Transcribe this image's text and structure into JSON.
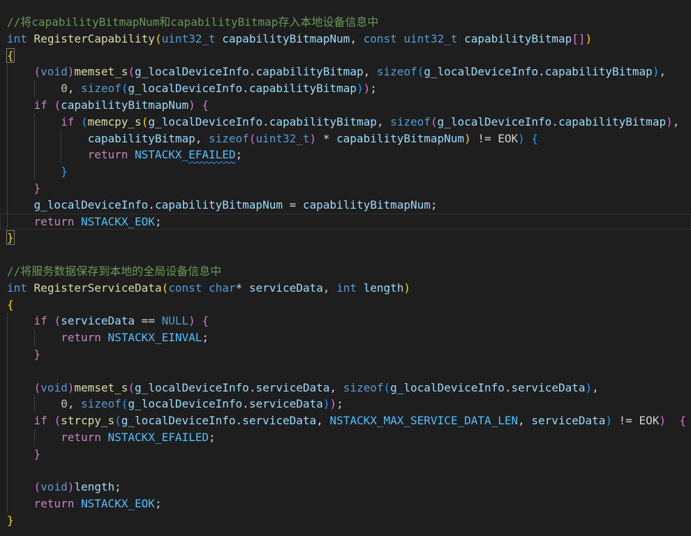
{
  "editor": {
    "lines": [
      {
        "indent": 0,
        "guides": 0,
        "tokens": [
          [
            "comment",
            "//将capabilityBitmapNum和capabilityBitmap存入本地设备信息中"
          ]
        ]
      },
      {
        "indent": 0,
        "guides": 0,
        "tokens": [
          [
            "keyword",
            "int"
          ],
          [
            "plain",
            " "
          ],
          [
            "function",
            "RegisterCapability"
          ],
          [
            "bracket1",
            "("
          ],
          [
            "keyword",
            "uint32_t"
          ],
          [
            "plain",
            " "
          ],
          [
            "variable",
            "capabilityBitmapNum"
          ],
          [
            "plain",
            ", "
          ],
          [
            "keyword",
            "const"
          ],
          [
            "plain",
            " "
          ],
          [
            "keyword",
            "uint32_t"
          ],
          [
            "plain",
            " "
          ],
          [
            "variable",
            "capabilityBitmap"
          ],
          [
            "bracket2",
            "[]"
          ],
          [
            "bracket1",
            ")"
          ]
        ]
      },
      {
        "indent": 0,
        "guides": 0,
        "tokens": [
          [
            "bracket1 matched",
            "{"
          ]
        ]
      },
      {
        "indent": 4,
        "guides": 1,
        "tokens": [
          [
            "bracket2",
            "("
          ],
          [
            "keyword",
            "void"
          ],
          [
            "bracket2",
            ")"
          ],
          [
            "function",
            "memset_s"
          ],
          [
            "bracket2",
            "("
          ],
          [
            "variable",
            "g_localDeviceInfo"
          ],
          [
            "plain",
            "."
          ],
          [
            "variable",
            "capabilityBitmap"
          ],
          [
            "plain",
            ", "
          ],
          [
            "keyword",
            "sizeof"
          ],
          [
            "bracket3",
            "("
          ],
          [
            "variable",
            "g_localDeviceInfo"
          ],
          [
            "plain",
            "."
          ],
          [
            "variable",
            "capabilityBitmap"
          ],
          [
            "bracket3",
            ")"
          ],
          [
            "plain",
            ","
          ]
        ]
      },
      {
        "indent": 8,
        "guides": 2,
        "tokens": [
          [
            "number",
            "0"
          ],
          [
            "plain",
            ", "
          ],
          [
            "keyword",
            "sizeof"
          ],
          [
            "bracket3",
            "("
          ],
          [
            "variable",
            "g_localDeviceInfo"
          ],
          [
            "plain",
            "."
          ],
          [
            "variable",
            "capabilityBitmap"
          ],
          [
            "bracket3",
            ")"
          ],
          [
            "bracket2",
            ")"
          ],
          [
            "plain",
            ";"
          ]
        ]
      },
      {
        "indent": 4,
        "guides": 1,
        "tokens": [
          [
            "control",
            "if"
          ],
          [
            "plain",
            " "
          ],
          [
            "bracket2",
            "("
          ],
          [
            "variable",
            "capabilityBitmapNum"
          ],
          [
            "bracket2",
            ")"
          ],
          [
            "plain",
            " "
          ],
          [
            "bracket2",
            "{"
          ]
        ]
      },
      {
        "indent": 8,
        "guides": 2,
        "tokens": [
          [
            "control",
            "if"
          ],
          [
            "plain",
            " "
          ],
          [
            "bracket3",
            "("
          ],
          [
            "function",
            "memcpy_s"
          ],
          [
            "bracket1",
            "("
          ],
          [
            "variable",
            "g_localDeviceInfo"
          ],
          [
            "plain",
            "."
          ],
          [
            "variable",
            "capabilityBitmap"
          ],
          [
            "plain",
            ", "
          ],
          [
            "keyword",
            "sizeof"
          ],
          [
            "bracket2",
            "("
          ],
          [
            "variable",
            "g_localDeviceInfo"
          ],
          [
            "plain",
            "."
          ],
          [
            "variable",
            "capabilityBitmap"
          ],
          [
            "bracket2",
            ")"
          ],
          [
            "plain",
            ","
          ]
        ]
      },
      {
        "indent": 12,
        "guides": 3,
        "tokens": [
          [
            "variable",
            "capabilityBitmap"
          ],
          [
            "plain",
            ", "
          ],
          [
            "keyword",
            "sizeof"
          ],
          [
            "bracket2",
            "("
          ],
          [
            "keyword",
            "uint32_t"
          ],
          [
            "bracket2",
            ")"
          ],
          [
            "plain",
            " * "
          ],
          [
            "variable",
            "capabilityBitmapNum"
          ],
          [
            "bracket1",
            ")"
          ],
          [
            "plain",
            " != EOK"
          ],
          [
            "bracket3",
            ")"
          ],
          [
            "plain",
            " "
          ],
          [
            "bracket3",
            "{"
          ]
        ]
      },
      {
        "indent": 12,
        "guides": 3,
        "tokens": [
          [
            "control",
            "return"
          ],
          [
            "plain",
            " "
          ],
          [
            "constant",
            "NSTACKX_"
          ],
          [
            "constant squiggle",
            "EFAILED"
          ],
          [
            "plain",
            ";"
          ]
        ]
      },
      {
        "indent": 8,
        "guides": 2,
        "tokens": [
          [
            "bracket3",
            "}"
          ]
        ]
      },
      {
        "indent": 4,
        "guides": 1,
        "tokens": [
          [
            "bracket2",
            "}"
          ]
        ]
      },
      {
        "indent": 4,
        "guides": 1,
        "tokens": [
          [
            "variable",
            "g_localDeviceInfo"
          ],
          [
            "plain",
            "."
          ],
          [
            "variable",
            "capabilityBitmapNum"
          ],
          [
            "plain",
            " = "
          ],
          [
            "variable",
            "capabilityBitmapNum"
          ],
          [
            "plain",
            ";"
          ]
        ]
      },
      {
        "indent": 4,
        "guides": 1,
        "active": true,
        "tokens": [
          [
            "control",
            "return"
          ],
          [
            "plain",
            " "
          ],
          [
            "constant",
            "NSTACKX_EOK"
          ],
          [
            "plain",
            ";"
          ]
        ]
      },
      {
        "indent": 0,
        "guides": 0,
        "tokens": [
          [
            "bracket1 matched",
            "}"
          ]
        ]
      },
      {
        "indent": 0,
        "guides": 0,
        "tokens": []
      },
      {
        "indent": 0,
        "guides": 0,
        "tokens": [
          [
            "comment",
            "//将服务数据保存到本地的全局设备信息中"
          ]
        ]
      },
      {
        "indent": 0,
        "guides": 0,
        "tokens": [
          [
            "keyword",
            "int"
          ],
          [
            "plain",
            " "
          ],
          [
            "function",
            "RegisterServiceData"
          ],
          [
            "bracket1",
            "("
          ],
          [
            "keyword",
            "const"
          ],
          [
            "plain",
            " "
          ],
          [
            "keyword",
            "char"
          ],
          [
            "plain",
            "* "
          ],
          [
            "variable",
            "serviceData"
          ],
          [
            "plain",
            ", "
          ],
          [
            "keyword",
            "int"
          ],
          [
            "plain",
            " "
          ],
          [
            "variable",
            "length"
          ],
          [
            "bracket1",
            ")"
          ]
        ]
      },
      {
        "indent": 0,
        "guides": 0,
        "tokens": [
          [
            "bracket1",
            "{"
          ]
        ]
      },
      {
        "indent": 4,
        "guides": 1,
        "tokens": [
          [
            "control",
            "if"
          ],
          [
            "plain",
            " "
          ],
          [
            "bracket2",
            "("
          ],
          [
            "variable",
            "serviceData"
          ],
          [
            "plain",
            " == "
          ],
          [
            "keyword",
            "NULL"
          ],
          [
            "bracket2",
            ")"
          ],
          [
            "plain",
            " "
          ],
          [
            "bracket2",
            "{"
          ]
        ]
      },
      {
        "indent": 8,
        "guides": 2,
        "tokens": [
          [
            "control",
            "return"
          ],
          [
            "plain",
            " "
          ],
          [
            "constant",
            "NSTACKX_EINVAL"
          ],
          [
            "plain",
            ";"
          ]
        ]
      },
      {
        "indent": 4,
        "guides": 1,
        "tokens": [
          [
            "bracket2",
            "}"
          ]
        ]
      },
      {
        "indent": 4,
        "guides": 1,
        "tokens": []
      },
      {
        "indent": 4,
        "guides": 1,
        "tokens": [
          [
            "bracket2",
            "("
          ],
          [
            "keyword",
            "void"
          ],
          [
            "bracket2",
            ")"
          ],
          [
            "function",
            "memset_s"
          ],
          [
            "bracket2",
            "("
          ],
          [
            "variable",
            "g_localDeviceInfo"
          ],
          [
            "plain",
            "."
          ],
          [
            "variable",
            "serviceData"
          ],
          [
            "plain",
            ", "
          ],
          [
            "keyword",
            "sizeof"
          ],
          [
            "bracket3",
            "("
          ],
          [
            "variable",
            "g_localDeviceInfo"
          ],
          [
            "plain",
            "."
          ],
          [
            "variable",
            "serviceData"
          ],
          [
            "bracket3",
            ")"
          ],
          [
            "plain",
            ","
          ]
        ]
      },
      {
        "indent": 8,
        "guides": 2,
        "tokens": [
          [
            "number",
            "0"
          ],
          [
            "plain",
            ", "
          ],
          [
            "keyword",
            "sizeof"
          ],
          [
            "bracket3",
            "("
          ],
          [
            "variable",
            "g_localDeviceInfo"
          ],
          [
            "plain",
            "."
          ],
          [
            "variable",
            "serviceData"
          ],
          [
            "bracket3",
            ")"
          ],
          [
            "bracket2",
            ")"
          ],
          [
            "plain",
            ";"
          ]
        ]
      },
      {
        "indent": 4,
        "guides": 1,
        "tokens": [
          [
            "control",
            "if"
          ],
          [
            "plain",
            " "
          ],
          [
            "bracket2",
            "("
          ],
          [
            "function",
            "strcpy_s"
          ],
          [
            "bracket3",
            "("
          ],
          [
            "variable",
            "g_localDeviceInfo"
          ],
          [
            "plain",
            "."
          ],
          [
            "variable",
            "serviceData"
          ],
          [
            "plain",
            ", "
          ],
          [
            "constant",
            "NSTACKX_MAX_SERVICE_DATA_LEN"
          ],
          [
            "plain",
            ", "
          ],
          [
            "variable",
            "serviceData"
          ],
          [
            "bracket3",
            ")"
          ],
          [
            "plain",
            " != EOK"
          ],
          [
            "bracket2",
            ")"
          ],
          [
            "plain",
            "  "
          ],
          [
            "bracket2",
            "{"
          ]
        ]
      },
      {
        "indent": 8,
        "guides": 2,
        "tokens": [
          [
            "control",
            "return"
          ],
          [
            "plain",
            " "
          ],
          [
            "constant",
            "NSTACKX_EFAILED"
          ],
          [
            "plain",
            ";"
          ]
        ]
      },
      {
        "indent": 4,
        "guides": 1,
        "tokens": [
          [
            "bracket2",
            "}"
          ]
        ]
      },
      {
        "indent": 4,
        "guides": 1,
        "tokens": []
      },
      {
        "indent": 4,
        "guides": 1,
        "tokens": [
          [
            "bracket2",
            "("
          ],
          [
            "keyword",
            "void"
          ],
          [
            "bracket2",
            ")"
          ],
          [
            "variable",
            "length"
          ],
          [
            "plain",
            ";"
          ]
        ]
      },
      {
        "indent": 4,
        "guides": 1,
        "tokens": [
          [
            "control",
            "return"
          ],
          [
            "plain",
            " "
          ],
          [
            "constant",
            "NSTACKX_EOK"
          ],
          [
            "plain",
            ";"
          ]
        ]
      },
      {
        "indent": 0,
        "guides": 0,
        "tokens": [
          [
            "bracket1",
            "}"
          ]
        ]
      }
    ]
  },
  "colors": {
    "background": "#1e1e1e",
    "comment": "#6a9955",
    "keyword": "#569cd6",
    "control": "#c586c0",
    "function": "#dcdcaa",
    "variable": "#9cdcfe",
    "constant": "#4fc1ff",
    "number": "#b5cea8",
    "text": "#d4d4d4",
    "bracket_level_1": "#ffd700",
    "bracket_level_2": "#da70d6",
    "bracket_level_3": "#179fff"
  }
}
